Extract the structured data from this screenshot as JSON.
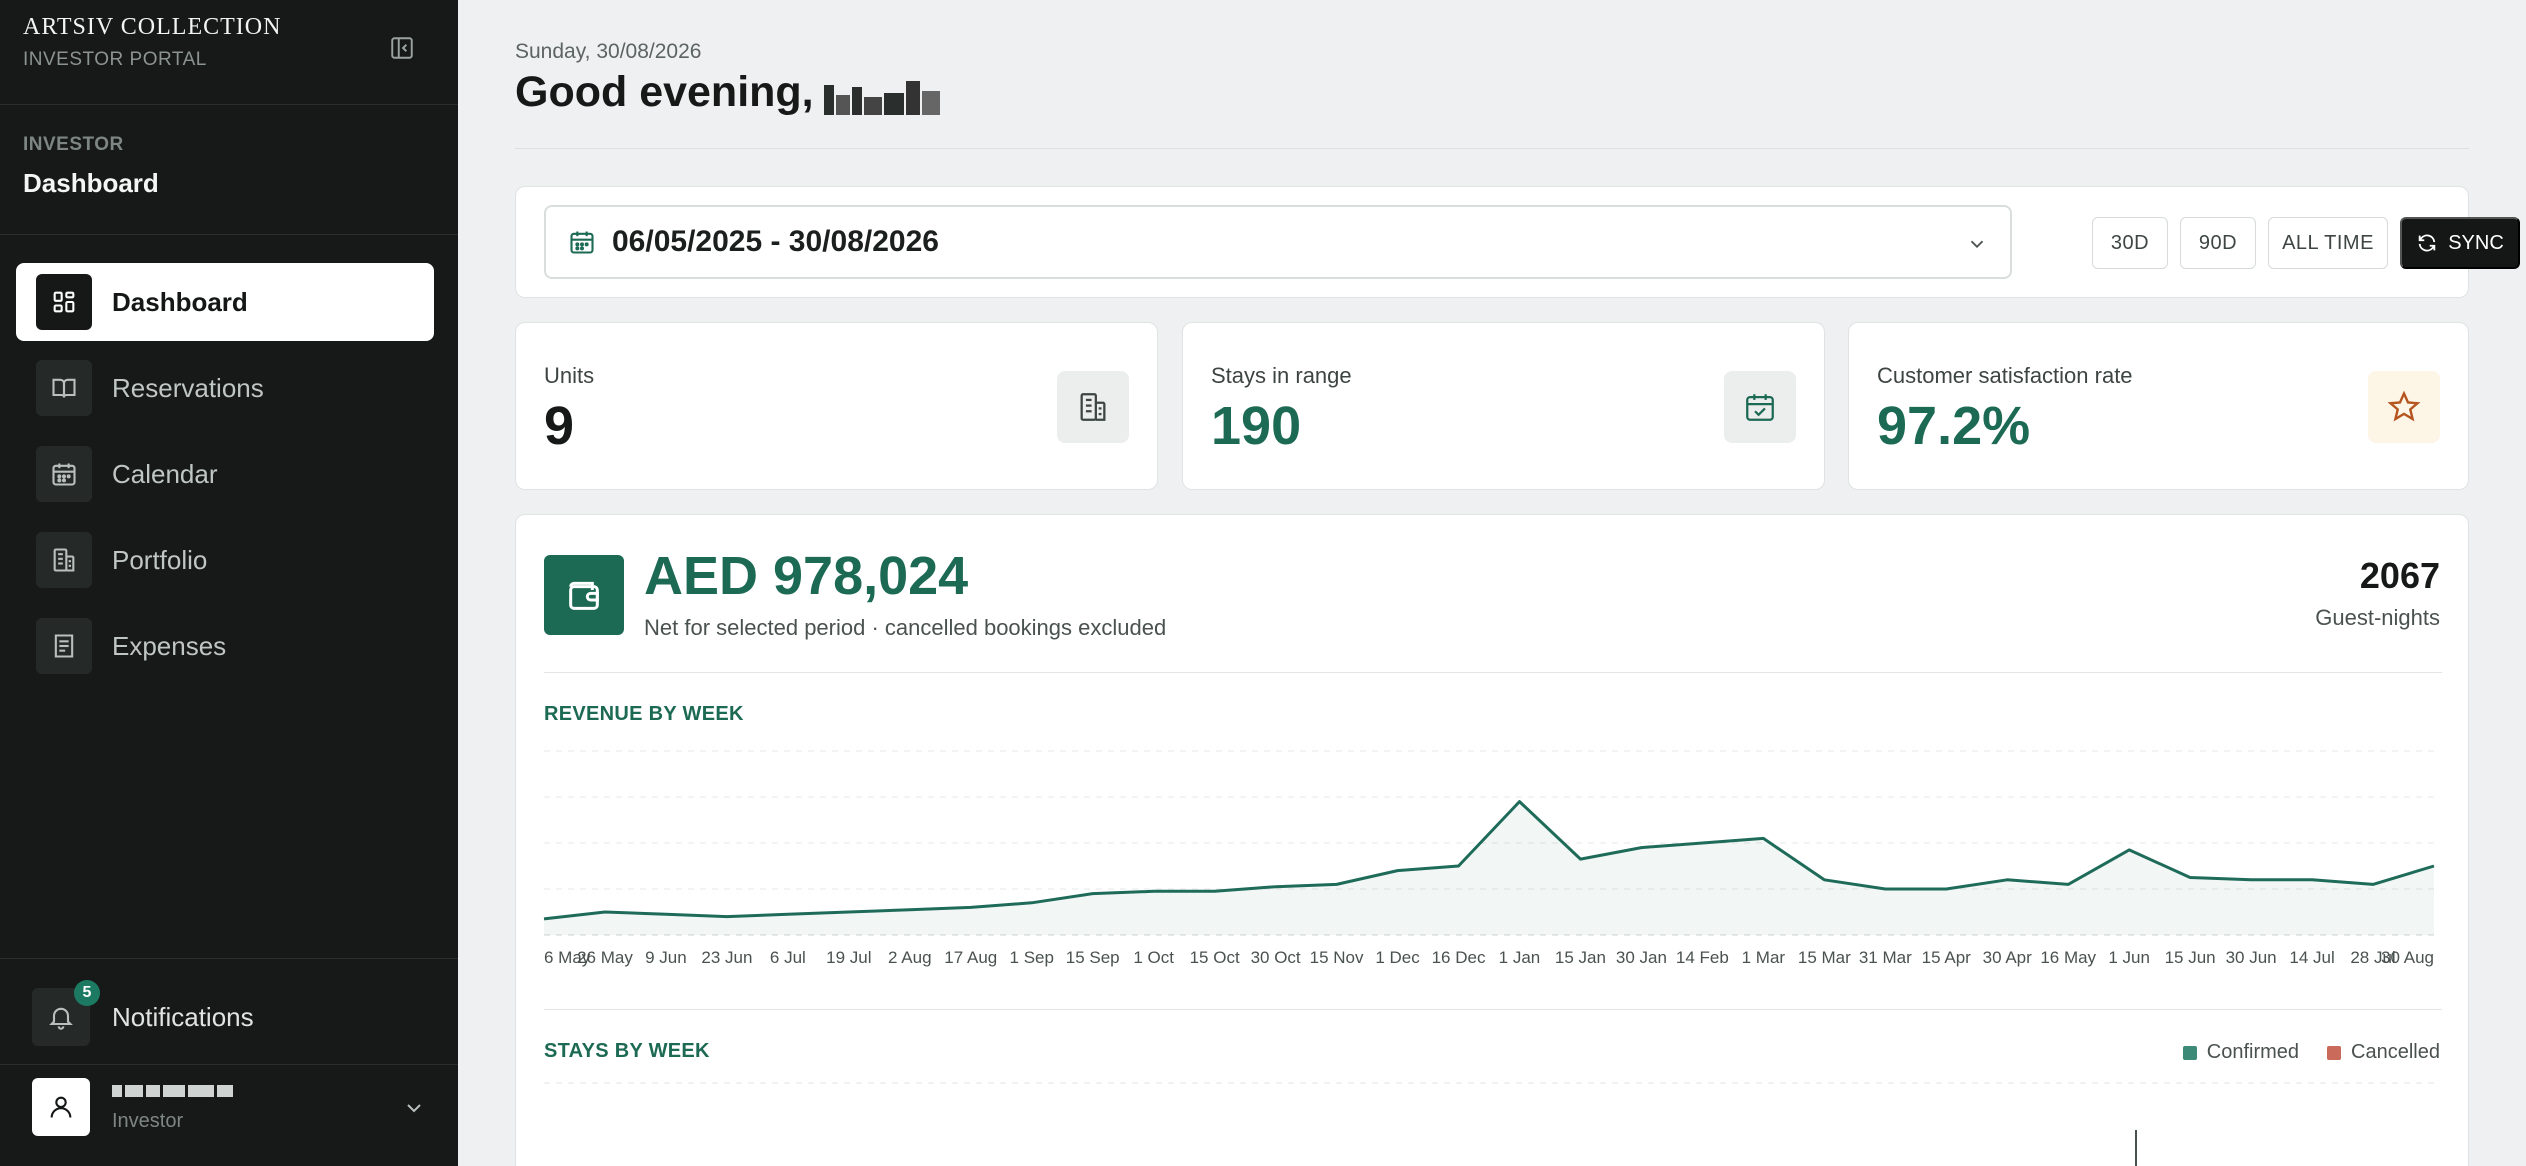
{
  "sidebar": {
    "brand_name": "ARTSIV COLLECTION",
    "brand_sub": "INVESTOR PORTAL",
    "section_label": "INVESTOR",
    "section_title": "Dashboard",
    "items": [
      {
        "label": "Dashboard",
        "icon": "grid-icon",
        "active": true
      },
      {
        "label": "Reservations",
        "icon": "book-icon",
        "active": false
      },
      {
        "label": "Calendar",
        "icon": "calendar-icon",
        "active": false
      },
      {
        "label": "Portfolio",
        "icon": "building-icon",
        "active": false
      },
      {
        "label": "Expenses",
        "icon": "receipt-icon",
        "active": false
      }
    ],
    "notifications_label": "Notifications",
    "notifications_count": "5",
    "user_role": "Investor"
  },
  "header": {
    "date": "Sunday, 30/08/2026",
    "greeting": "Good evening,"
  },
  "filters": {
    "date_range": "06/05/2025 - 30/08/2026",
    "buttons": [
      "30D",
      "90D",
      "ALL TIME"
    ],
    "sync_label": "SYNC"
  },
  "stats": [
    {
      "label": "Units",
      "value": "9"
    },
    {
      "label": "Stays in range",
      "value": "190"
    },
    {
      "label": "Customer satisfaction rate",
      "value": "97.2%"
    }
  ],
  "revenue": {
    "amount": "AED 978,024",
    "subtitle": "Net for selected period · cancelled bookings excluded",
    "guest_nights_value": "2067",
    "guest_nights_label": "Guest-nights"
  },
  "colors": {
    "brand_green": "#1d6a54",
    "line": "#1f6b5a",
    "confirmed": "#3e8a78",
    "cancelled": "#c96a5a",
    "sidebar_bg": "#161918"
  },
  "chart_data": [
    {
      "type": "line",
      "title": "REVENUE BY WEEK",
      "x": [
        "6 May",
        "26 May",
        "9 Jun",
        "23 Jun",
        "6 Jul",
        "19 Jul",
        "2 Aug",
        "17 Aug",
        "1 Sep",
        "15 Sep",
        "1 Oct",
        "15 Oct",
        "30 Oct",
        "15 Nov",
        "1 Dec",
        "16 Dec",
        "1 Jan",
        "15 Jan",
        "30 Jan",
        "14 Feb",
        "1 Mar",
        "15 Mar",
        "31 Mar",
        "15 Apr",
        "30 Apr",
        "16 May",
        "1 Jun",
        "15 Jun",
        "30 Jun",
        "14 Jul",
        "28 Jul",
        "30 Aug"
      ],
      "tick_labels": [
        "6 May",
        "26 May",
        "9 Jun",
        "23 Jun",
        "6 Jul",
        "19 Jul",
        "2 Aug",
        "17 Aug",
        "1 Sep",
        "15 Sep",
        "1 Oct",
        "15 Oct",
        "30 Oct",
        "15 Nov",
        "1 Dec",
        "16 Dec",
        "1 Jan",
        "15 Jan",
        "30 Jan",
        "14 Feb",
        "1 Mar",
        "15 Mar",
        "31 Mar",
        "15 Apr",
        "30 Apr",
        "16 May",
        "1 Jun",
        "15 Jun",
        "30 Jun",
        "14 Jul",
        "28 Jul",
        "30 Aug"
      ],
      "values": [
        7,
        10,
        9,
        8,
        9,
        10,
        11,
        12,
        14,
        18,
        19,
        19,
        21,
        22,
        28,
        30,
        58,
        33,
        38,
        40,
        42,
        24,
        20,
        20,
        24,
        22,
        37,
        25,
        24,
        24,
        22,
        30
      ],
      "ylim": [
        0,
        80
      ],
      "grid": true,
      "area_fill": true
    },
    {
      "type": "bar",
      "title": "STAYS BY WEEK",
      "series": [
        {
          "name": "Confirmed",
          "values": []
        },
        {
          "name": "Cancelled",
          "values": []
        }
      ],
      "legend": "top-right",
      "grid": true
    }
  ]
}
